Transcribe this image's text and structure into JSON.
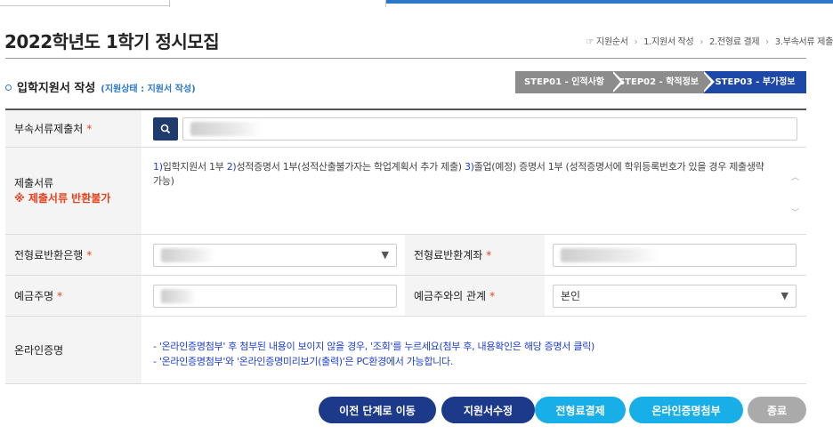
{
  "page": {
    "title": "2022학년도 1학기 정시모집"
  },
  "breadcrumb": {
    "lead_icon": "hand-pointer-icon",
    "lead": "지원순서",
    "items": [
      "1.지원서 작성",
      "2.전형료 결제",
      "3.부속서류 제출"
    ]
  },
  "section": {
    "title": "입학지원서 작성",
    "status": "(지원상태 : 지원서 작성)"
  },
  "steps": [
    {
      "label": "STEP01 - 인적사항",
      "state": "done"
    },
    {
      "label": "STEP02 - 학적정보",
      "state": "done"
    },
    {
      "label": "STEP03 - 부가정보",
      "state": "current"
    }
  ],
  "form": {
    "docs_office": {
      "label": "부속서류제출처",
      "required": "*"
    },
    "documents": {
      "label": "제출서류",
      "warning": "※ 제출서류 반환불가",
      "n1": "1)",
      "t1": "입학지원서 1부",
      "n2": "2)",
      "t2": "성적증명서 1부(성적산출불가자는 학업계획서 추가 제출)",
      "n3": "3)",
      "t3": "졸업(예정) 증명서 1부 (성적증명서에 학위등록번호가 있을 경우 제출생략가능)"
    },
    "refund_bank": {
      "label": "전형료반환은행",
      "required": "*"
    },
    "refund_account": {
      "label": "전형료반환계좌",
      "required": "*"
    },
    "account_holder": {
      "label": "예금주명",
      "required": "*"
    },
    "holder_relation": {
      "label": "예금주와의 관계",
      "required": "*",
      "value": "본인"
    },
    "online_cert": {
      "label": "온라인증명",
      "line1": "- '온라인증명첨부' 후 첨부된 내용이 보이지 않을 경우, '조회'를 누르세요(첨부 후, 내용확인은 해당 증명서 클릭)",
      "line2": "- '온라인증명첨부'와 '온라인증명미리보기(출력)'은 PC환경에서 가능합니다."
    }
  },
  "buttons": {
    "prev": "이전 단계로 이동",
    "edit": "지원서수정",
    "pay": "전형료결제",
    "attach": "온라인증명첨부",
    "close": "종료"
  },
  "colors": {
    "primary": "#1d3a8a",
    "accent": "#18aee8",
    "required": "#e5411e",
    "step_active": "#1d48a8"
  }
}
